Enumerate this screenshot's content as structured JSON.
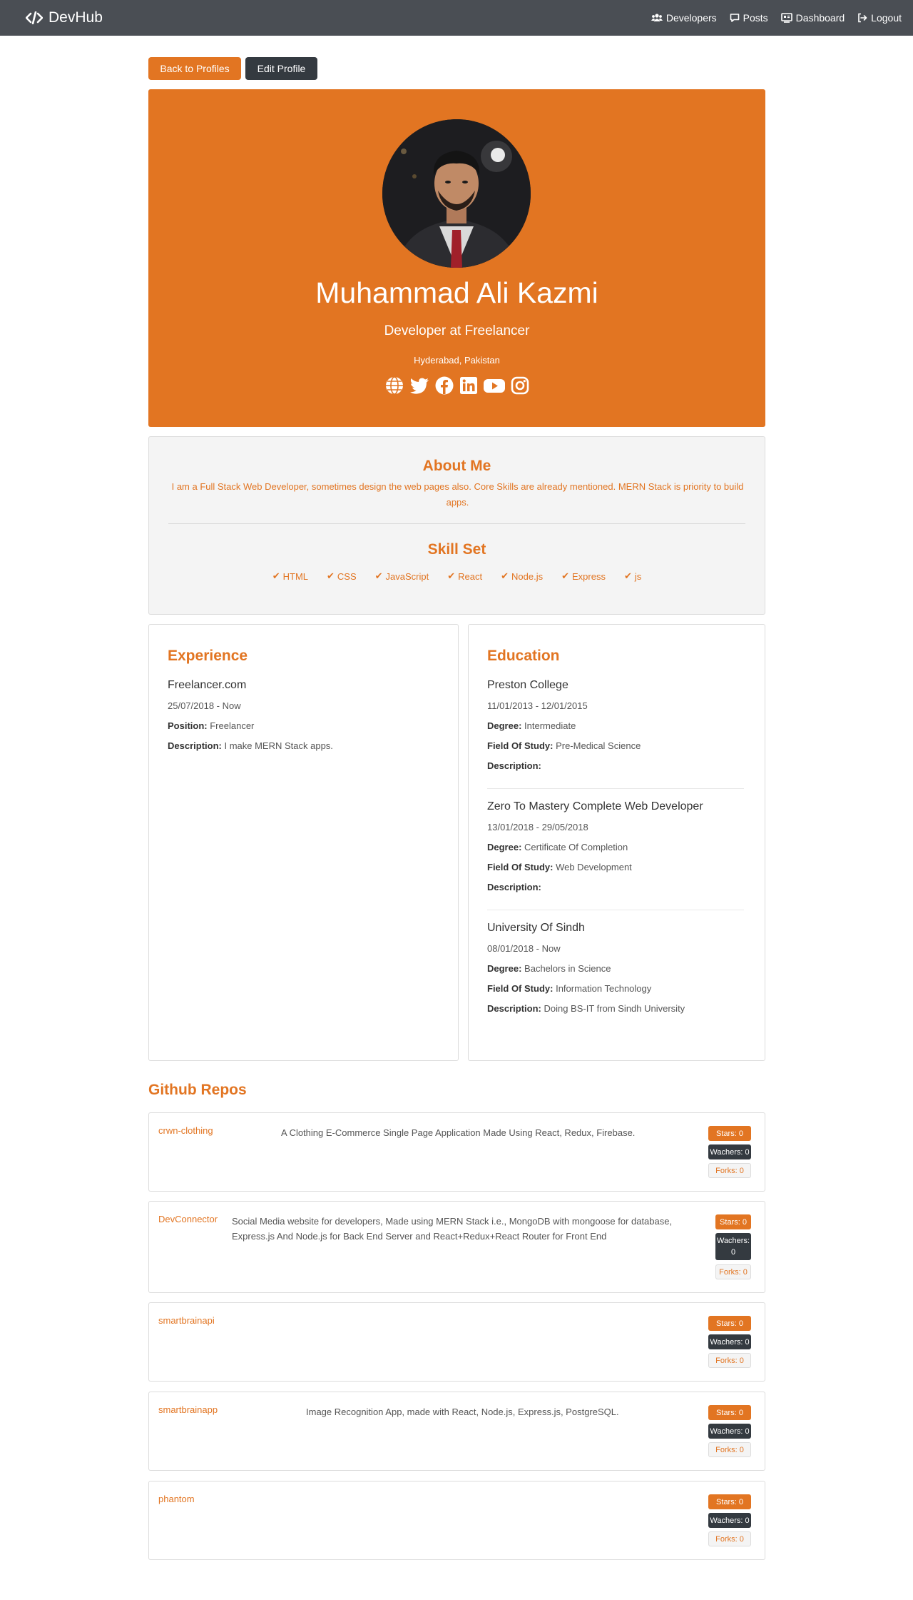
{
  "nav": {
    "brand": "DevHub",
    "links": [
      {
        "label": "Developers",
        "icon": "users-icon"
      },
      {
        "label": "Posts",
        "icon": "comment-icon"
      },
      {
        "label": "Dashboard",
        "icon": "dashboard-icon"
      },
      {
        "label": "Logout",
        "icon": "logout-icon"
      }
    ]
  },
  "actions": {
    "back": "Back to Profiles",
    "edit": "Edit Profile"
  },
  "profile": {
    "name": "Muhammad Ali Kazmi",
    "status": "Developer at Freelancer",
    "location": "Hyderabad, Pakistan",
    "socials": [
      "globe-icon",
      "twitter-icon",
      "facebook-icon",
      "linkedin-icon",
      "youtube-icon",
      "instagram-icon"
    ]
  },
  "about": {
    "title": "About Me",
    "bio": "I am a Full Stack Web Developer, sometimes design the web pages also. Core Skills are already mentioned. MERN Stack is priority to build apps.",
    "skills_title": "Skill Set",
    "skills": [
      "HTML",
      "CSS",
      "JavaScript",
      "React",
      "Node.js",
      "Express",
      "js"
    ]
  },
  "experience": {
    "title": "Experience",
    "items": [
      {
        "company": "Freelancer.com",
        "dates": "25/07/2018 - Now",
        "position_label": "Position:",
        "position": "Freelancer",
        "description_label": "Description:",
        "description": "I make MERN Stack apps."
      }
    ]
  },
  "education": {
    "title": "Education",
    "items": [
      {
        "school": "Preston College",
        "dates": "11/01/2013 - 12/01/2015",
        "degree_label": "Degree:",
        "degree": "Intermediate",
        "field_label": "Field Of Study:",
        "field": "Pre-Medical Science",
        "description_label": "Description:",
        "description": ""
      },
      {
        "school": "Zero To Mastery Complete Web Developer",
        "dates": "13/01/2018 - 29/05/2018",
        "degree_label": "Degree:",
        "degree": "Certificate Of Completion",
        "field_label": "Field Of Study:",
        "field": "Web Development",
        "description_label": "Description:",
        "description": ""
      },
      {
        "school": "University Of Sindh",
        "dates": "08/01/2018 - Now",
        "degree_label": "Degree:",
        "degree": "Bachelors in Science",
        "field_label": "Field Of Study:",
        "field": "Information Technology",
        "description_label": "Description:",
        "description": "Doing BS-IT from Sindh University"
      }
    ]
  },
  "repos": {
    "title": "Github Repos",
    "items": [
      {
        "name": "crwn-clothing",
        "description": "A Clothing E-Commerce Single Page Application Made Using React, Redux, Firebase.",
        "stars": "Stars: 0",
        "watchers": "Wachers: 0",
        "forks": "Forks: 0"
      },
      {
        "name": "DevConnector",
        "description": "Social Media website for developers, Made using MERN Stack i.e., MongoDB with mongoose for database, Express.js And Node.js for Back End Server and React+Redux+React Router for Front End",
        "stars": "Stars: 0",
        "watchers": "Wachers: 0",
        "forks": "Forks: 0"
      },
      {
        "name": "smartbrainapi",
        "description": "",
        "stars": "Stars: 0",
        "watchers": "Wachers: 0",
        "forks": "Forks: 0"
      },
      {
        "name": "smartbrainapp",
        "description": "Image Recognition App, made with React, Node.js, Express.js, PostgreSQL.",
        "stars": "Stars: 0",
        "watchers": "Wachers: 0",
        "forks": "Forks: 0"
      },
      {
        "name": "phantom",
        "description": "",
        "stars": "Stars: 0",
        "watchers": "Wachers: 0",
        "forks": "Forks: 0"
      }
    ]
  },
  "colors": {
    "accent": "#e27522",
    "navbar": "#4a4e54",
    "dark_button": "#343a40",
    "bio_background": "#f4f4f4"
  }
}
